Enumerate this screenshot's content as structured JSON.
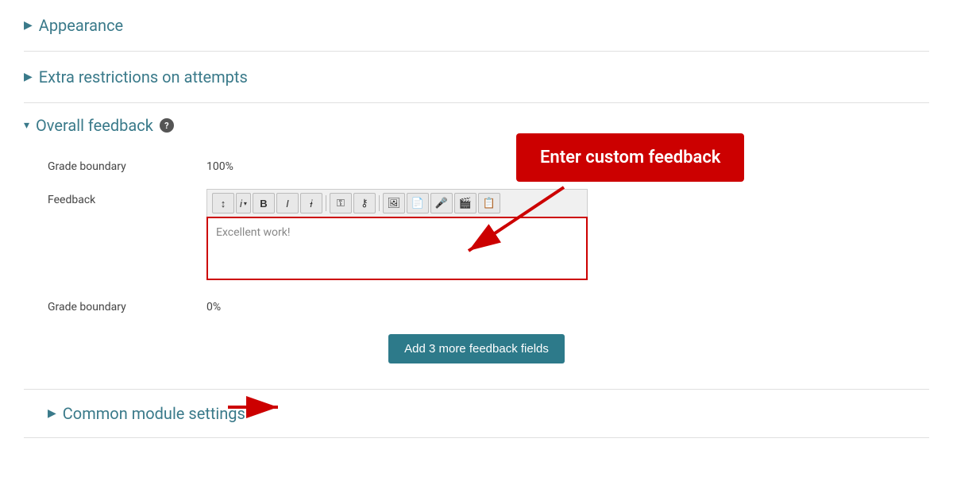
{
  "sections": {
    "appearance": {
      "label": "Appearance",
      "chevron": "▶"
    },
    "extra_restrictions": {
      "label": "Extra restrictions on attempts",
      "chevron": "▶"
    },
    "overall_feedback": {
      "label": "Overall feedback",
      "chevron": "▾",
      "help_title": "?"
    },
    "common_module": {
      "label": "Common module settings",
      "chevron": "▶"
    }
  },
  "form": {
    "grade_boundary_1": {
      "label": "Grade boundary",
      "value": "100%"
    },
    "feedback": {
      "label": "Feedback",
      "placeholder": "Excellent work!",
      "toolbar": {
        "buttons": [
          "↕",
          "i",
          "▾",
          "B",
          "I",
          "it",
          "⊘",
          "⊗",
          "🖼",
          "📋",
          "🎤",
          "🎬",
          "📋"
        ]
      }
    },
    "grade_boundary_2": {
      "label": "Grade boundary",
      "value": "0%"
    }
  },
  "add_button": {
    "label": "Add 3 more feedback fields"
  },
  "annotation": {
    "label": "Enter custom feedback"
  },
  "colors": {
    "teal": "#3a7a8a",
    "red": "#cc0000",
    "btn_bg": "#2d7a8a"
  }
}
